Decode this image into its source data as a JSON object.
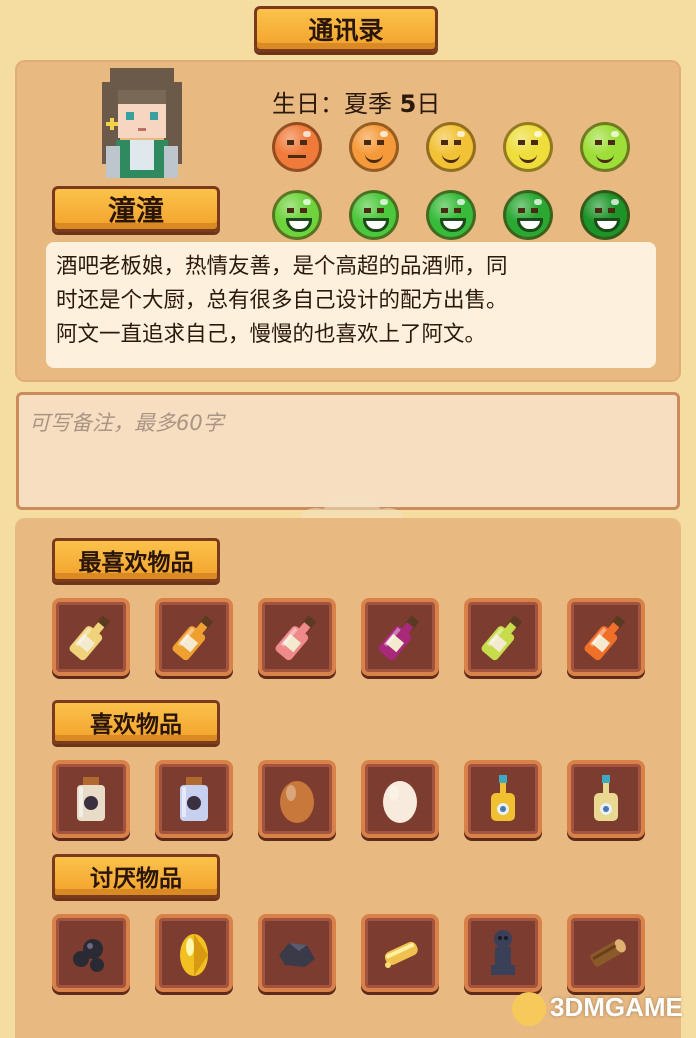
{
  "header": {
    "title": "通讯录"
  },
  "profile": {
    "name": "潼潼",
    "birthday_label": "生日：",
    "birthday_season": "夏季",
    "birthday_day": "5",
    "birthday_suffix": "日",
    "description_lines": [
      "酒吧老板娘，热情友善，是个高超的品酒师，同",
      "时还是个大厨，总有很多自己设计的配方出售。",
      "阿文一直追求自己，慢慢的也喜欢上了阿文。"
    ]
  },
  "affection": {
    "faces": [
      {
        "icon": "face-sad-icon",
        "color": "#f07a3a",
        "expr": "flat"
      },
      {
        "icon": "face-neutral-icon",
        "color": "#f59a3a",
        "expr": "smile"
      },
      {
        "icon": "face-smile-icon",
        "color": "#f2c236",
        "expr": "smile"
      },
      {
        "icon": "face-smile-icon",
        "color": "#eedd3a",
        "expr": "smile"
      },
      {
        "icon": "face-smile-icon",
        "color": "#9ede38",
        "expr": "smile"
      },
      {
        "icon": "face-happy-icon",
        "color": "#6ed33c",
        "expr": "grin"
      },
      {
        "icon": "face-happy-icon",
        "color": "#4cc83c",
        "expr": "grin"
      },
      {
        "icon": "face-happy-icon",
        "color": "#38bb3a",
        "expr": "grin"
      },
      {
        "icon": "face-happy-icon",
        "color": "#2aa832",
        "expr": "grin"
      },
      {
        "icon": "face-happy-icon",
        "color": "#1c9428",
        "expr": "grin"
      }
    ]
  },
  "notes": {
    "placeholder": "可写备注，最多60字"
  },
  "sections": [
    {
      "label": "最喜欢物品",
      "items": [
        {
          "icon": "wine-bottle-icon",
          "color": "#f0d27a"
        },
        {
          "icon": "wine-bottle-icon",
          "color": "#f0a030"
        },
        {
          "icon": "wine-bottle-icon",
          "color": "#f08a8a"
        },
        {
          "icon": "wine-bottle-icon",
          "color": "#a8287a"
        },
        {
          "icon": "wine-bottle-icon",
          "color": "#c6dc4a"
        },
        {
          "icon": "wine-bottle-icon",
          "color": "#f0702a"
        }
      ]
    },
    {
      "label": "喜欢物品",
      "items": [
        {
          "icon": "jar-icon",
          "color": "#e8dcc8"
        },
        {
          "icon": "jar-icon",
          "color": "#c8d0f0"
        },
        {
          "icon": "brown-egg-icon",
          "color": "#c8783a"
        },
        {
          "icon": "white-egg-icon",
          "color": "#f8eadc"
        },
        {
          "icon": "potion-bottle-icon",
          "color": "#f0c030"
        },
        {
          "icon": "potion-bottle-icon",
          "color": "#e8d890"
        }
      ]
    },
    {
      "label": "讨厌物品",
      "items": [
        {
          "icon": "coal-icon",
          "color": "#2a2a34"
        },
        {
          "icon": "gold-ore-icon",
          "color": "#f2c020"
        },
        {
          "icon": "stone-icon",
          "color": "#3a3a48"
        },
        {
          "icon": "bread-icon",
          "color": "#f0c050"
        },
        {
          "icon": "statue-icon",
          "color": "#3a4058"
        },
        {
          "icon": "log-icon",
          "color": "#8a5a2a"
        }
      ]
    }
  ],
  "watermark": {
    "text": "3DMGAME"
  }
}
